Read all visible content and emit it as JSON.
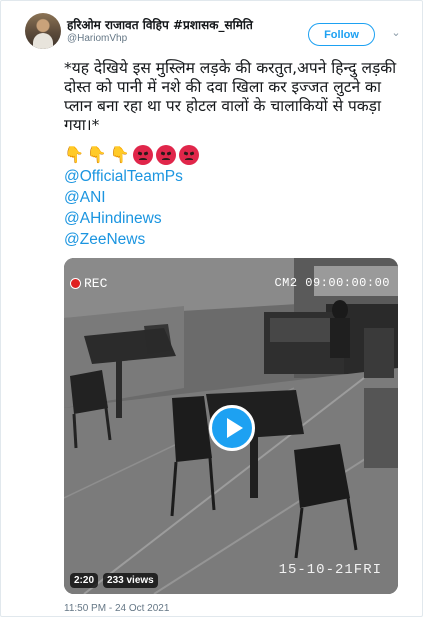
{
  "user": {
    "display_name": "हरिओम राजावत विहिप #प्रशासक_समिति",
    "handle": "@HariomVhp"
  },
  "actions": {
    "follow_label": "Follow",
    "caret_icon": "chevron-down-icon"
  },
  "tweet": {
    "text": "*यह देखिये इस मुस्लिम लड़के की करतुत,अपने हिन्दु लड़की दोस्त को पानी में नशे की दवा खिला कर  इज्जत लुटने का प्लान बना रहा था पर होटल वालों  के चालाकियों से पकड़ा गया।*",
    "emojis": [
      "pointing-down",
      "pointing-down",
      "pointing-down",
      "angry-face",
      "angry-face",
      "angry-face"
    ],
    "mentions": [
      "@OfficialTeamPs",
      "@ANI",
      "@AHindinews",
      "@ZeeNews"
    ]
  },
  "video": {
    "rec_label": "REC",
    "camera_label": "CM2 09:00:00:00",
    "date_overlay": "15-10-21FRI",
    "duration": "2:20",
    "views": "233 views"
  },
  "timestamp": "11:50 PM - 24 Oct 2021",
  "colors": {
    "accent": "#1da1f2",
    "link": "#1b95e0",
    "muted": "#657786"
  }
}
